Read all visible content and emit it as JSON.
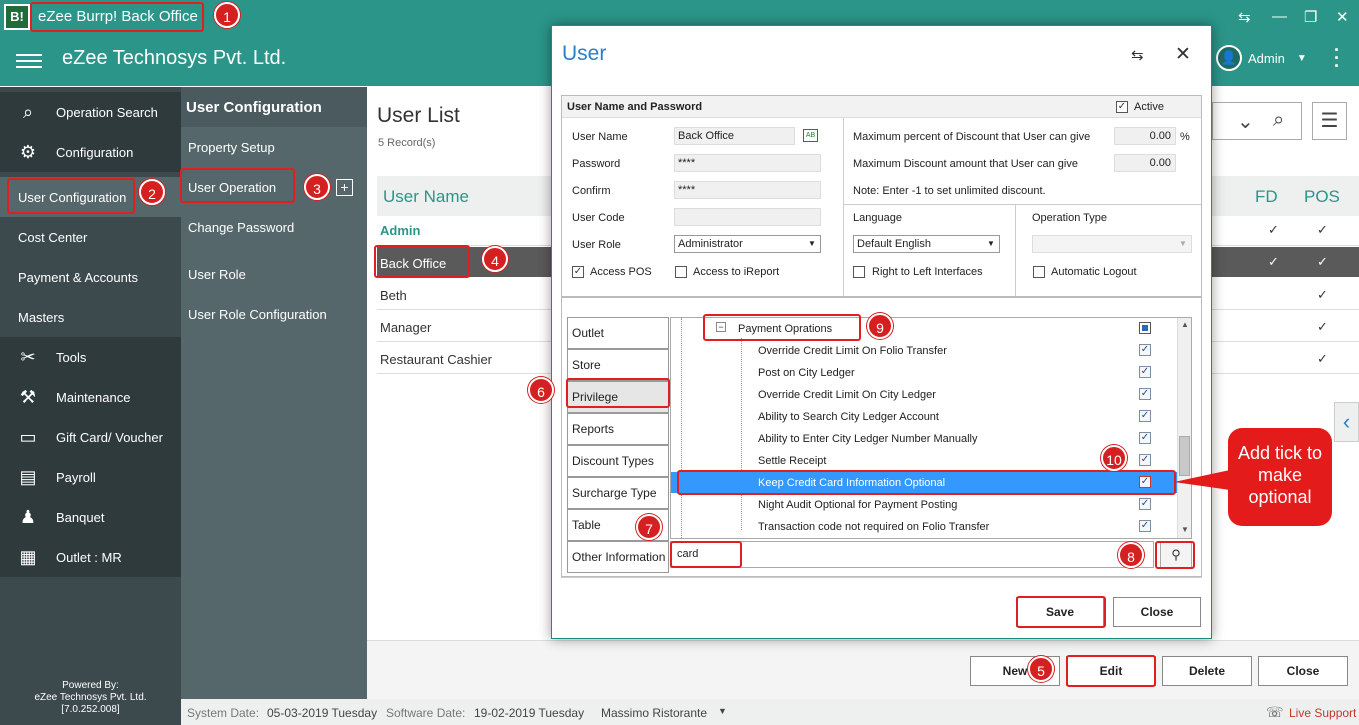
{
  "window": {
    "app_icon": "B!",
    "title": "eZee Burrp! Back Office"
  },
  "header": {
    "company": "eZee Technosys Pvt. Ltd.",
    "user": "Admin"
  },
  "sidebar": {
    "items": [
      {
        "label": "Operation Search",
        "icon": "search-icon"
      },
      {
        "label": "Configuration",
        "icon": "gear-icon"
      },
      {
        "label": "User Configuration"
      },
      {
        "label": "Cost Center"
      },
      {
        "label": "Payment & Accounts"
      },
      {
        "label": "Masters"
      },
      {
        "label": "Tools",
        "icon": "tools-icon"
      },
      {
        "label": "Maintenance",
        "icon": "maintenance-icon"
      },
      {
        "label": "Gift Card/ Voucher",
        "icon": "gift-card-icon"
      },
      {
        "label": "Payroll",
        "icon": "payroll-icon"
      },
      {
        "label": "Banquet",
        "icon": "banquet-icon"
      },
      {
        "label": "Outlet : MR",
        "icon": "outlet-icon"
      }
    ],
    "powered_by": [
      "Powered By:",
      "eZee Technosys Pvt. Ltd.",
      "[7.0.252.008]"
    ]
  },
  "submenu": {
    "title": "User Configuration",
    "items": [
      "Property Setup",
      "User Operation",
      "Change Password",
      "User Role",
      "User Role Configuration"
    ]
  },
  "main": {
    "title": "User List",
    "records": "5 Record(s)",
    "columns": {
      "user_name": "User Name",
      "fd": "FD",
      "pos": "POS"
    },
    "rows": [
      {
        "name": "Admin",
        "fd": "✓",
        "pos": "✓"
      },
      {
        "name": "Back Office",
        "fd": "✓",
        "pos": "✓"
      },
      {
        "name": "Beth",
        "fd": "",
        "pos": "✓"
      },
      {
        "name": "Manager",
        "fd": "",
        "pos": "✓"
      },
      {
        "name": "Restaurant Cashier",
        "fd": "",
        "pos": "✓"
      }
    ],
    "buttons": {
      "new": "New",
      "edit": "Edit",
      "delete": "Delete",
      "close": "Close"
    }
  },
  "statusbar": {
    "system_date_label": "System Date:",
    "system_date": "05-03-2019 Tuesday",
    "software_date_label": "Software Date:",
    "software_date": "19-02-2019 Tuesday",
    "outlet": "Massimo Ristorante",
    "live_support": "Live Support"
  },
  "dialog": {
    "title": "User",
    "section": "User Name and Password",
    "active_label": "Active",
    "fields": {
      "user_name": {
        "label": "User Name",
        "value": "Back Office"
      },
      "password": {
        "label": "Password",
        "value": "****"
      },
      "confirm": {
        "label": "Confirm",
        "value": "****"
      },
      "user_code": {
        "label": "User Code",
        "value": ""
      },
      "user_role": {
        "label": "User Role",
        "value": "Administrator"
      }
    },
    "access_pos": "Access POS",
    "access_ireport": "Access to iReport",
    "max_percent_label": "Maximum percent of Discount that User can give",
    "max_percent_value": "0.00",
    "percent_sign": "%",
    "max_amount_label": "Maximum Discount amount that User can give",
    "max_amount_value": "0.00",
    "note": "Note: Enter -1 to set unlimited discount.",
    "language_label": "Language",
    "language_value": "Default English",
    "rtl_label": "Right to Left Interfaces",
    "op_type_label": "Operation Type",
    "auto_logout": "Automatic Logout",
    "tabs": [
      "Outlet",
      "Store",
      "Privilege",
      "Reports",
      "Discount Types",
      "Surcharge Type",
      "Table",
      "Other Information"
    ],
    "tree_parent": "Payment Oprations",
    "tree_items": [
      "Override Credit Limit On Folio Transfer",
      "Post on City Ledger",
      "Override Credit Limit On City Ledger",
      "Ability to Search City Ledger Account",
      "Ability to Enter City Ledger Number Manually",
      "Settle Receipt",
      "Keep Credit Card Information Optional",
      "Night Audit Optional for Payment Posting",
      "Transaction code not required on Folio Transfer"
    ],
    "search_value": "card",
    "save": "Save",
    "close": "Close"
  },
  "callout": "Add tick to make optional",
  "badges": [
    "1",
    "2",
    "3",
    "4",
    "5",
    "6",
    "7",
    "8",
    "9",
    "10"
  ],
  "colors": {
    "header": "#2b9589",
    "sidebar": "#3c4a4e",
    "submenu": "#56676b",
    "accent": "#2b9589",
    "highlight": "#e02020",
    "selected_row": "#5a5a5a",
    "tree_selected": "#3399ff"
  }
}
